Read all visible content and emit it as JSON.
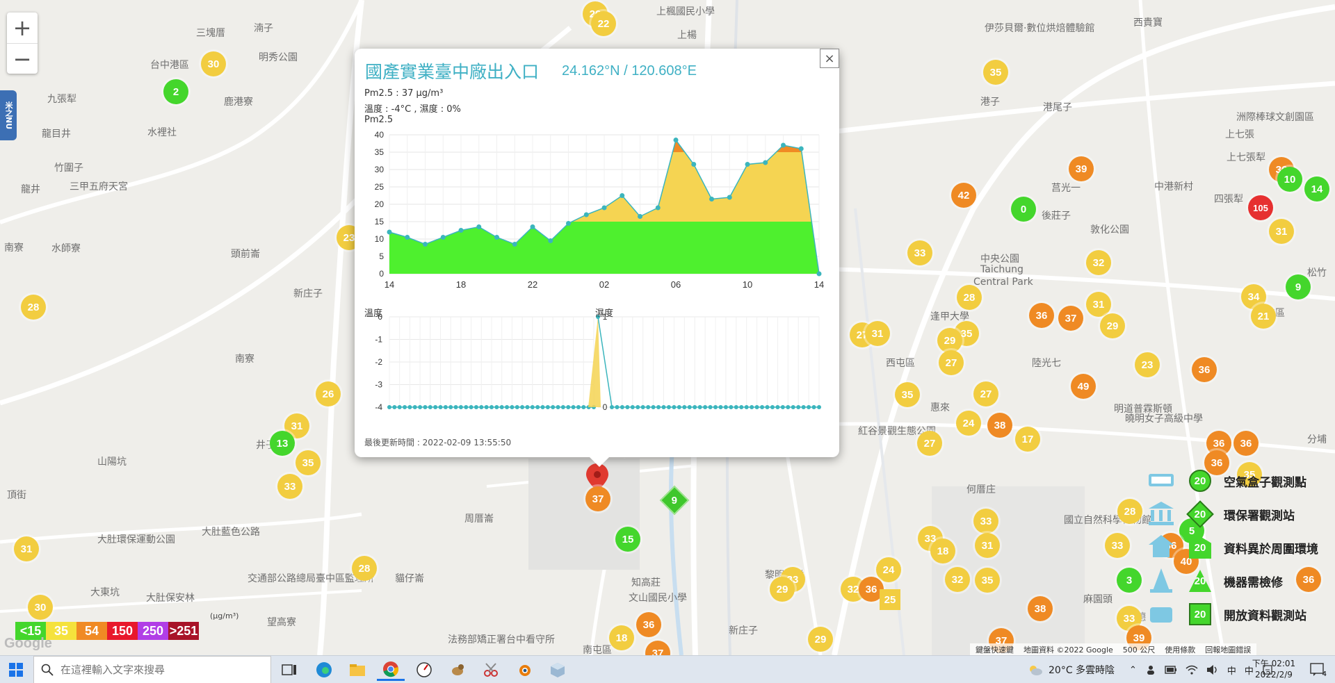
{
  "map": {
    "places": [
      {
        "name": "三塊厝",
        "x": 282,
        "y": 37
      },
      {
        "name": "湳子",
        "x": 365,
        "y": 30
      },
      {
        "name": "明秀公園",
        "x": 372,
        "y": 72
      },
      {
        "name": "台中港區",
        "x": 216,
        "y": 83
      },
      {
        "name": "鹿港寮",
        "x": 322,
        "y": 136
      },
      {
        "name": "九張犁",
        "x": 68,
        "y": 132
      },
      {
        "name": "水裡社",
        "x": 212,
        "y": 180
      },
      {
        "name": "龍目井",
        "x": 60,
        "y": 182
      },
      {
        "name": "竹圍子",
        "x": 78,
        "y": 231
      },
      {
        "name": "三甲五府天宮",
        "x": 100,
        "y": 258
      },
      {
        "name": "龍井",
        "x": 30,
        "y": 262
      },
      {
        "name": "南寮",
        "x": 6,
        "y": 346
      },
      {
        "name": "水師寮",
        "x": 74,
        "y": 347
      },
      {
        "name": "頭前崙",
        "x": 332,
        "y": 355
      },
      {
        "name": "新庄子",
        "x": 422,
        "y": 412
      },
      {
        "name": "南寮",
        "x": 338,
        "y": 506
      },
      {
        "name": "井子頭",
        "x": 368,
        "y": 630
      },
      {
        "name": "山陽坑",
        "x": 140,
        "y": 654
      },
      {
        "name": "頂街",
        "x": 10,
        "y": 702
      },
      {
        "name": "大肚藍色公路",
        "x": 290,
        "y": 755
      },
      {
        "name": "大肚環保運動公園",
        "x": 140,
        "y": 766
      },
      {
        "name": "大東坑",
        "x": 130,
        "y": 842
      },
      {
        "name": "大肚保安林",
        "x": 210,
        "y": 850
      },
      {
        "name": "交通部公路總局臺中區監理所",
        "x": 356,
        "y": 822
      },
      {
        "name": "貓仔崙",
        "x": 568,
        "y": 822
      },
      {
        "name": "周厝崙",
        "x": 668,
        "y": 736
      },
      {
        "name": "知高莊",
        "x": 908,
        "y": 828
      },
      {
        "name": "文山國民小學",
        "x": 904,
        "y": 850
      },
      {
        "name": "望高寮",
        "x": 384,
        "y": 885
      },
      {
        "name": "法務部矯正署台中看守所",
        "x": 644,
        "y": 910
      },
      {
        "name": "南屯區",
        "x": 838,
        "y": 925
      },
      {
        "name": "新庄子",
        "x": 1048,
        "y": 897
      },
      {
        "name": "黎明新村",
        "x": 1100,
        "y": 817
      },
      {
        "name": "何厝庄",
        "x": 1390,
        "y": 694
      },
      {
        "name": "惠來",
        "x": 1338,
        "y": 576
      },
      {
        "name": "西屯區",
        "x": 1274,
        "y": 512
      },
      {
        "name": "紅谷景觀生態公園",
        "x": 1234,
        "y": 610
      },
      {
        "name": "中央公園",
        "x": 1410,
        "y": 362
      },
      {
        "name": "Taichung",
        "x": 1410,
        "y": 380
      },
      {
        "name": "Central Park",
        "x": 1400,
        "y": 398
      },
      {
        "name": "逢甲大學",
        "x": 1338,
        "y": 445
      },
      {
        "name": "陸光七",
        "x": 1484,
        "y": 512
      },
      {
        "name": "後莊子",
        "x": 1498,
        "y": 300
      },
      {
        "name": "莒光一",
        "x": 1512,
        "y": 260
      },
      {
        "name": "敦化公園",
        "x": 1568,
        "y": 320
      },
      {
        "name": "港子",
        "x": 1410,
        "y": 136
      },
      {
        "name": "港尾子",
        "x": 1500,
        "y": 144
      },
      {
        "name": "伊莎貝爾·數位烘焙體驗館",
        "x": 1416,
        "y": 30
      },
      {
        "name": "西貴寶",
        "x": 1630,
        "y": 22
      },
      {
        "name": "中港新村",
        "x": 1660,
        "y": 258
      },
      {
        "name": "上七張",
        "x": 1762,
        "y": 183
      },
      {
        "name": "上七張犁",
        "x": 1764,
        "y": 216
      },
      {
        "name": "四張犁",
        "x": 1746,
        "y": 276
      },
      {
        "name": "洲際棒球文創園區",
        "x": 1778,
        "y": 158
      },
      {
        "name": "北屯區",
        "x": 1806,
        "y": 440
      },
      {
        "name": "國立自然科學博物館",
        "x": 1530,
        "y": 738
      },
      {
        "name": "麻園頭",
        "x": 1558,
        "y": 852
      },
      {
        "name": "華德",
        "x": 1620,
        "y": 878
      },
      {
        "name": "明道普霖斯頓",
        "x": 1602,
        "y": 578
      },
      {
        "name": "曉明女子高級中學",
        "x": 1618,
        "y": 592
      },
      {
        "name": "分埔",
        "x": 1880,
        "y": 622
      },
      {
        "name": "松竹",
        "x": 1880,
        "y": 382
      },
      {
        "name": "上楊",
        "x": 974,
        "y": 40
      },
      {
        "name": "上楓國民小學",
        "x": 944,
        "y": 6
      }
    ],
    "markers": [
      {
        "v": "20",
        "c": "yellow",
        "x": 856,
        "y": 20
      },
      {
        "v": "22",
        "c": "yellow",
        "x": 868,
        "y": 34
      },
      {
        "v": "30",
        "c": "yellow",
        "x": 307,
        "y": 92
      },
      {
        "v": "2",
        "c": "green",
        "x": 253,
        "y": 132
      },
      {
        "v": "23",
        "c": "yellow",
        "x": 502,
        "y": 342
      },
      {
        "v": "28",
        "c": "yellow",
        "x": 48,
        "y": 442
      },
      {
        "v": "26",
        "c": "yellow",
        "x": 472,
        "y": 567
      },
      {
        "v": "31",
        "c": "yellow",
        "x": 427,
        "y": 613
      },
      {
        "v": "13",
        "c": "green",
        "x": 406,
        "y": 638
      },
      {
        "v": "35",
        "c": "yellow",
        "x": 443,
        "y": 666
      },
      {
        "v": "33",
        "c": "yellow",
        "x": 417,
        "y": 700
      },
      {
        "v": "31",
        "c": "yellow",
        "x": 38,
        "y": 790
      },
      {
        "v": "28",
        "c": "yellow",
        "x": 524,
        "y": 818
      },
      {
        "v": "30",
        "c": "yellow",
        "x": 58,
        "y": 874
      },
      {
        "v": "15",
        "c": "green",
        "x": 903,
        "y": 776
      },
      {
        "v": "36",
        "c": "orange",
        "x": 933,
        "y": 899
      },
      {
        "v": "18",
        "c": "yellow",
        "x": 894,
        "y": 918
      },
      {
        "v": "37",
        "c": "orange",
        "x": 946,
        "y": 940
      },
      {
        "v": "35",
        "c": "yellow",
        "x": 1432,
        "y": 104
      },
      {
        "v": "39",
        "c": "orange",
        "x": 1555,
        "y": 243
      },
      {
        "v": "42",
        "c": "orange",
        "x": 1386,
        "y": 281
      },
      {
        "v": "0",
        "c": "green",
        "x": 1472,
        "y": 301
      },
      {
        "v": "33",
        "c": "yellow",
        "x": 1323,
        "y": 364
      },
      {
        "v": "32",
        "c": "yellow",
        "x": 1580,
        "y": 378
      },
      {
        "v": "28",
        "c": "yellow",
        "x": 1394,
        "y": 428
      },
      {
        "v": "31",
        "c": "yellow",
        "x": 1580,
        "y": 438
      },
      {
        "v": "36",
        "c": "orange",
        "x": 1498,
        "y": 454
      },
      {
        "v": "37",
        "c": "orange",
        "x": 1540,
        "y": 458
      },
      {
        "v": "29",
        "c": "yellow",
        "x": 1600,
        "y": 469
      },
      {
        "v": "27",
        "c": "yellow",
        "x": 1240,
        "y": 482
      },
      {
        "v": "31",
        "c": "yellow",
        "x": 1262,
        "y": 480
      },
      {
        "v": "35",
        "c": "yellow",
        "x": 1390,
        "y": 480
      },
      {
        "v": "29",
        "c": "yellow",
        "x": 1366,
        "y": 490
      },
      {
        "v": "27",
        "c": "yellow",
        "x": 1368,
        "y": 522
      },
      {
        "v": "23",
        "c": "yellow",
        "x": 1650,
        "y": 525
      },
      {
        "v": "36",
        "c": "orange",
        "x": 1732,
        "y": 532
      },
      {
        "v": "49",
        "c": "orange",
        "x": 1558,
        "y": 556
      },
      {
        "v": "35",
        "c": "yellow",
        "x": 1305,
        "y": 568
      },
      {
        "v": "27",
        "c": "yellow",
        "x": 1418,
        "y": 567
      },
      {
        "v": "24",
        "c": "yellow",
        "x": 1393,
        "y": 609
      },
      {
        "v": "38",
        "c": "orange",
        "x": 1438,
        "y": 612
      },
      {
        "v": "17",
        "c": "yellow",
        "x": 1478,
        "y": 632
      },
      {
        "v": "27",
        "c": "yellow",
        "x": 1337,
        "y": 638
      },
      {
        "v": "36",
        "c": "orange",
        "x": 1753,
        "y": 638
      },
      {
        "v": "36",
        "c": "orange",
        "x": 1792,
        "y": 638
      },
      {
        "v": "36",
        "c": "orange",
        "x": 1750,
        "y": 666
      },
      {
        "v": "35",
        "c": "yellow",
        "x": 1797,
        "y": 683
      },
      {
        "v": "28",
        "c": "yellow",
        "x": 1625,
        "y": 736
      },
      {
        "v": "33",
        "c": "yellow",
        "x": 1418,
        "y": 750
      },
      {
        "v": "5",
        "c": "green",
        "x": 1714,
        "y": 764
      },
      {
        "v": "33",
        "c": "yellow",
        "x": 1338,
        "y": 775
      },
      {
        "v": "18",
        "c": "yellow",
        "x": 1356,
        "y": 793
      },
      {
        "v": "31",
        "c": "yellow",
        "x": 1420,
        "y": 785
      },
      {
        "v": "33",
        "c": "yellow",
        "x": 1607,
        "y": 785
      },
      {
        "v": "36",
        "c": "orange",
        "x": 1684,
        "y": 785
      },
      {
        "v": "40",
        "c": "orange",
        "x": 1706,
        "y": 808
      },
      {
        "v": "24",
        "c": "yellow",
        "x": 1278,
        "y": 820
      },
      {
        "v": "32",
        "c": "yellow",
        "x": 1377,
        "y": 834
      },
      {
        "v": "35",
        "c": "yellow",
        "x": 1420,
        "y": 835
      },
      {
        "v": "3",
        "c": "green",
        "x": 1624,
        "y": 835
      },
      {
        "v": "36",
        "c": "orange",
        "x": 1882,
        "y": 834
      },
      {
        "v": "33",
        "c": "yellow",
        "x": 1140,
        "y": 834
      },
      {
        "v": "29",
        "c": "yellow",
        "x": 1125,
        "y": 848
      },
      {
        "v": "32",
        "c": "yellow",
        "x": 1227,
        "y": 848
      },
      {
        "v": "36",
        "c": "orange",
        "x": 1253,
        "y": 848
      },
      {
        "v": "38",
        "c": "orange",
        "x": 1496,
        "y": 876
      },
      {
        "v": "33",
        "c": "yellow",
        "x": 1624,
        "y": 890
      },
      {
        "v": "37",
        "c": "orange",
        "x": 1440,
        "y": 922
      },
      {
        "v": "39",
        "c": "orange",
        "x": 1638,
        "y": 918
      },
      {
        "v": "29",
        "c": "yellow",
        "x": 1180,
        "y": 920
      },
      {
        "v": "36",
        "c": "orange",
        "x": 1843,
        "y": 244
      },
      {
        "v": "10",
        "c": "green",
        "x": 1855,
        "y": 258
      },
      {
        "v": "14",
        "c": "green",
        "x": 1894,
        "y": 272
      },
      {
        "v": "105",
        "c": "red",
        "x": 1813,
        "y": 299
      },
      {
        "v": "31",
        "c": "yellow",
        "x": 1843,
        "y": 333
      },
      {
        "v": "9",
        "c": "green",
        "x": 1867,
        "y": 413
      },
      {
        "v": "34",
        "c": "yellow",
        "x": 1803,
        "y": 427
      },
      {
        "v": "21",
        "c": "yellow",
        "x": 1817,
        "y": 455
      }
    ],
    "diamond_marker": {
      "v": "9"
    },
    "square_marker": {
      "v": "25"
    },
    "pin_marker": {
      "v": "37"
    }
  },
  "zoom": {
    "in": "+",
    "out": "−"
  },
  "side_tab": {
    "label": "米之NU"
  },
  "popup": {
    "close": "×",
    "title": "國產實業臺中廠出入口",
    "coord": "24.162°N / 120.608°E",
    "pm_line": "Pm2.5 : 37 μg/m³",
    "th_line": "溫度 : -4°C , 濕度 : 0%",
    "chart_label": "Pm2.5",
    "temp_label": "溫度",
    "humid_label": "濕度",
    "last_update": "最後更新時間 : 2022-02-09 13:55:50"
  },
  "chart_data": [
    {
      "type": "area",
      "title": "Pm2.5",
      "x": [
        "14",
        "15",
        "16",
        "17",
        "18",
        "19",
        "20",
        "21",
        "22",
        "23",
        "00",
        "01",
        "02",
        "03",
        "04",
        "05",
        "06",
        "07",
        "08",
        "09",
        "10",
        "11",
        "12",
        "13",
        "14"
      ],
      "xticks": [
        "14",
        "18",
        "22",
        "02",
        "06",
        "10",
        "14"
      ],
      "values": [
        12,
        10.5,
        8.5,
        10.5,
        12.5,
        13.5,
        10.5,
        8.5,
        13.5,
        9.5,
        14.5,
        17,
        19,
        22.5,
        16.5,
        19,
        38.5,
        31.5,
        21.5,
        22,
        31.5,
        32,
        37,
        36,
        0
      ],
      "ylim": [
        0,
        40
      ],
      "yticks": [
        0,
        5,
        10,
        15,
        20,
        25,
        30,
        35,
        40
      ],
      "thresholds": [
        15,
        35
      ],
      "colors": {
        "green": "#4ef02e",
        "yellow": "#f5d452",
        "orange": "#f08a24",
        "line": "#3bb5bd"
      }
    },
    {
      "type": "line",
      "title": "溫度",
      "ylim": [
        -4,
        0
      ],
      "yticks": [
        0,
        -1,
        -2,
        -3,
        -4
      ],
      "values": [
        -4,
        -4,
        -4,
        -4,
        -4,
        -4,
        -4,
        -4,
        -4,
        -4,
        -4,
        -4,
        -4,
        -4,
        -4,
        -4,
        -4,
        -4,
        -4,
        -4,
        -4,
        -4,
        -4,
        -4,
        -4,
        -4,
        -4,
        -4,
        -4,
        -4,
        -4,
        -4,
        -4,
        -4,
        -4,
        -4,
        -4,
        -4,
        -4,
        -4,
        -4
      ]
    },
    {
      "type": "line",
      "title": "濕度",
      "ylim": [
        0,
        1
      ],
      "yticks": [
        1,
        0
      ],
      "values": [
        1,
        0,
        0,
        0,
        0,
        0,
        0,
        0,
        0,
        0,
        0,
        0,
        0,
        0,
        0,
        0,
        0,
        0,
        0,
        0,
        0,
        0,
        0,
        0,
        0,
        0,
        0,
        0,
        0,
        0,
        0,
        0,
        0,
        0,
        0,
        0,
        0,
        0,
        0,
        0,
        0,
        0
      ]
    }
  ],
  "legend_right": [
    {
      "label": "空氣盒子觀測點",
      "badge": "20"
    },
    {
      "label": "環保署觀測站",
      "badge": "20"
    },
    {
      "label": "資料異於周圍環境",
      "badge": "20"
    },
    {
      "label": "機器需檢修",
      "badge": "20"
    },
    {
      "label": "開放資料觀測站",
      "badge": "20"
    }
  ],
  "legend_scale": {
    "unit": "(μg/m³)",
    "items": [
      {
        "label": "<15",
        "color": "#44d62c"
      },
      {
        "label": "35",
        "color": "#f5e23c"
      },
      {
        "label": "54",
        "color": "#f08a24"
      },
      {
        "label": "150",
        "color": "#e8182b"
      },
      {
        "label": "250",
        "color": "#b13ee6"
      },
      {
        "label": ">251",
        "color": "#a81328"
      }
    ]
  },
  "google_logo": "Google",
  "footer": {
    "shortcuts": "鍵盤快速鍵",
    "mapdata": "地圖資料 ©2022 Google",
    "scale": "500 公尺",
    "terms": "使用條款",
    "report": "回報地圖錯誤"
  },
  "taskbar": {
    "search_placeholder": "在這裡輸入文字來搜尋",
    "weather": "20°C 多雲時陰",
    "ime_1": "中",
    "ime_2": "中",
    "time": "下午 02:01",
    "date": "2022/2/9",
    "notify_count": "4"
  }
}
